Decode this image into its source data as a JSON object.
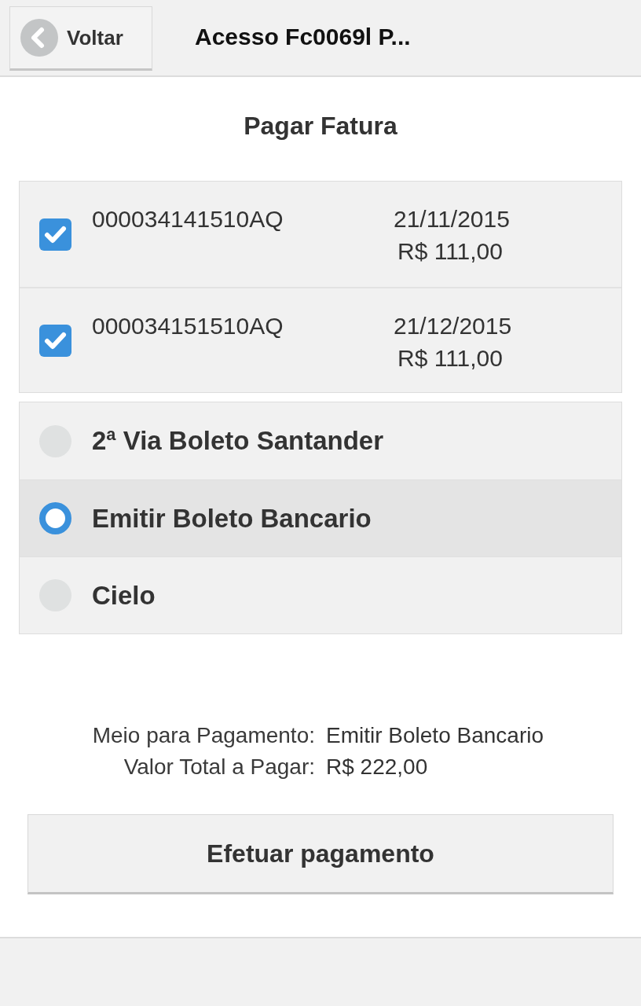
{
  "header": {
    "back_button": "Voltar",
    "title": "Acesso Fc0069l P..."
  },
  "heading": "Pagar Fatura",
  "invoices": [
    {
      "code": "000034141510AQ",
      "date": "21/11/2015",
      "amount": "R$ 111,00",
      "checked": true
    },
    {
      "code": "000034151510AQ",
      "date": "21/12/2015",
      "amount": "R$ 111,00",
      "checked": true
    }
  ],
  "payment_options": [
    {
      "label": "2ª Via Boleto Santander",
      "selected": false
    },
    {
      "label": "Emitir Boleto Bancario",
      "selected": true
    },
    {
      "label": "Cielo",
      "selected": false
    }
  ],
  "summary": [
    {
      "label": "Meio para Pagamento:",
      "value": "Emitir Boleto Bancario"
    },
    {
      "label": "Valor Total a Pagar:",
      "value": "R$ 222,00"
    }
  ],
  "submit_button": "Efetuar pagamento"
}
